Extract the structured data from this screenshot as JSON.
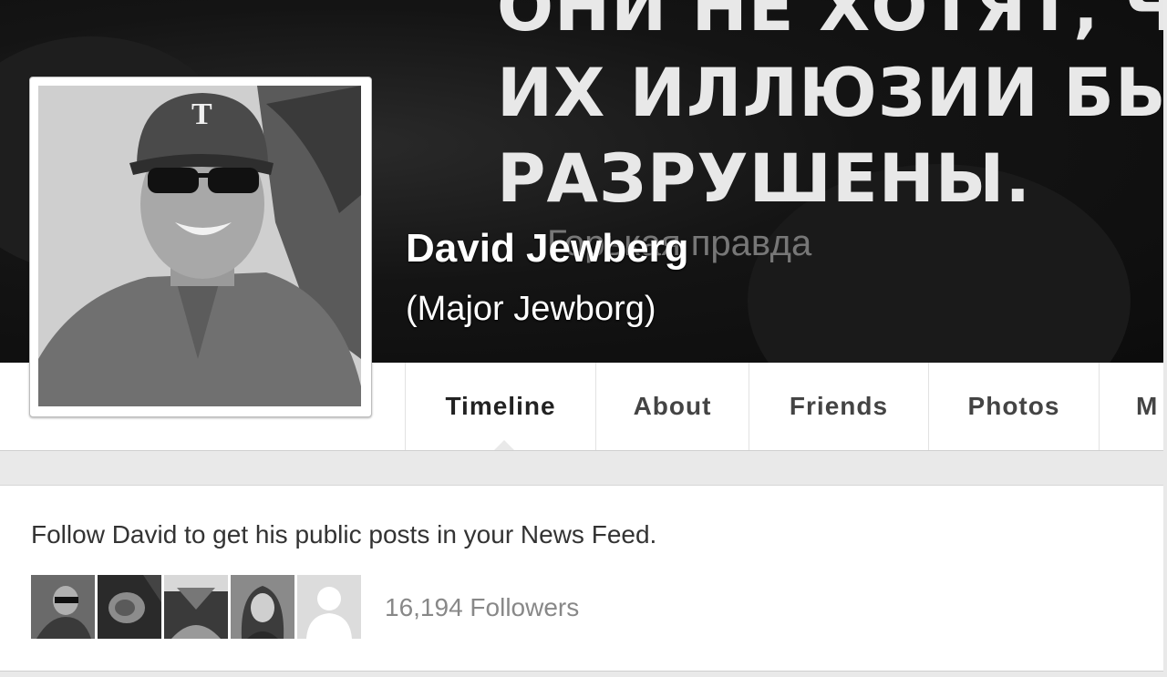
{
  "cover": {
    "text_lines": [
      "ОНИ НЕ ХОТЯТ, ЧТ",
      "ИХ ИЛЛЮЗИИ БЫЛ",
      "РАЗРУШЕНЫ."
    ],
    "sub_text": "Горькая правда"
  },
  "profile": {
    "name": "David Jewberg",
    "alternate_name": "(Major Jewborg)"
  },
  "tabs": [
    {
      "label": "Timeline",
      "active": true
    },
    {
      "label": "About",
      "active": false
    },
    {
      "label": "Friends",
      "active": false
    },
    {
      "label": "Photos",
      "active": false
    },
    {
      "label": "M",
      "active": false
    }
  ],
  "follow": {
    "prompt": "Follow David to get his public posts in your News Feed.",
    "followers_count": "16,194 Followers",
    "avatars": [
      "follower-avatar",
      "follower-avatar",
      "follower-avatar",
      "follower-avatar",
      "default-avatar-icon"
    ]
  },
  "colors": {
    "cover_bg": "#111111",
    "tab_text": "#444444",
    "follower_text": "#888888"
  }
}
